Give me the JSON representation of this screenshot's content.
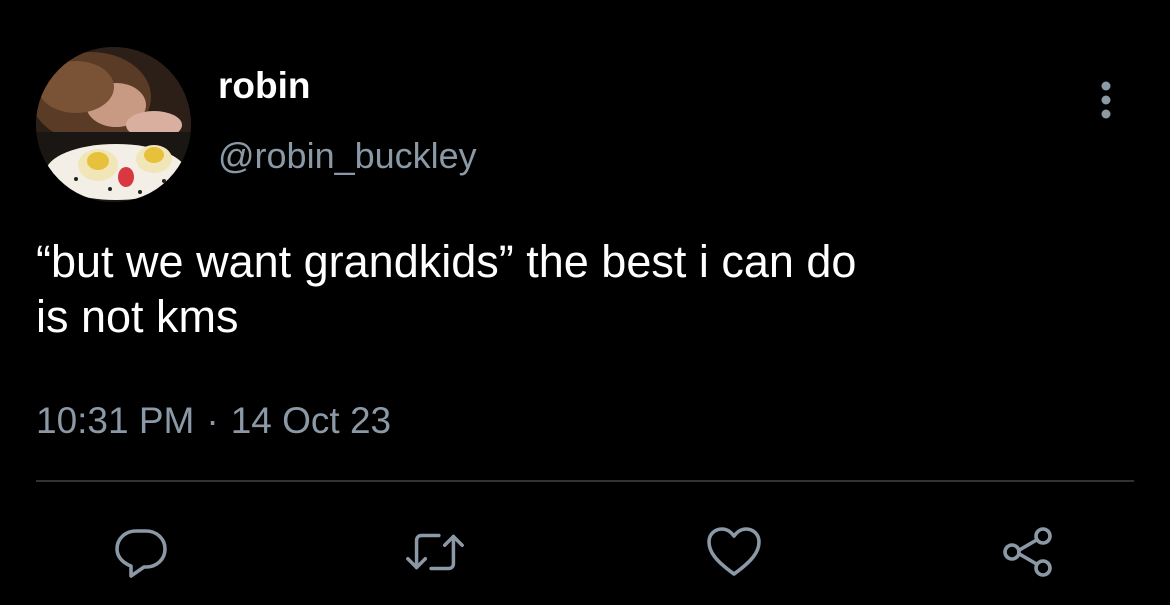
{
  "user": {
    "display_name": "robin",
    "handle": "@robin_buckley"
  },
  "tweet": {
    "text_lines": [
      "“but we want grandkids” the best i can do",
      "is not kms"
    ],
    "time": "10:31 PM",
    "separator": "·",
    "date": "14 Oct 23"
  },
  "actions": [
    {
      "name": "reply",
      "icon": "speech-bubble-icon"
    },
    {
      "name": "retweet",
      "icon": "retweet-arrows-icon"
    },
    {
      "name": "like",
      "icon": "heart-icon"
    },
    {
      "name": "share",
      "icon": "share-nodes-icon"
    }
  ],
  "colors": {
    "background": "#000000",
    "primary_text": "#ffffff",
    "secondary_text": "#8b98a5",
    "divider": "#2f3336"
  }
}
